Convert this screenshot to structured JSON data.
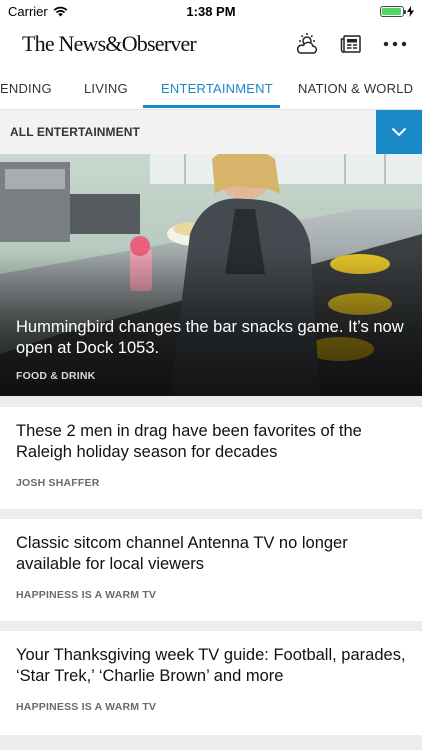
{
  "status_bar": {
    "carrier": "Carrier",
    "time": "1:38 PM",
    "battery_level": 0.95
  },
  "header": {
    "logo": "The News&Observer",
    "icons": [
      "weather-icon",
      "e-edition-icon",
      "more-icon"
    ]
  },
  "tabs": [
    {
      "label": "ENDING",
      "active": false
    },
    {
      "label": "LIVING",
      "active": false
    },
    {
      "label": "ENTERTAINMENT",
      "active": true
    },
    {
      "label": "NATION & WORLD",
      "active": false
    }
  ],
  "section": {
    "title": "ALL ENTERTAINMENT"
  },
  "hero": {
    "headline": "Hummingbird changes the bar snacks game. It’s now open at Dock 1053.",
    "tag": "FOOD & DRINK"
  },
  "articles": [
    {
      "headline": "These 2 men in drag have been favorites of the Raleigh holiday season for decades",
      "tag": "JOSH SHAFFER"
    },
    {
      "headline": "Classic sitcom channel Antenna TV no longer available for local viewers",
      "tag": "HAPPINESS IS A WARM TV"
    },
    {
      "headline": "Your Thanksgiving week TV guide: Football, parades, ‘Star Trek,’ ‘Charlie Brown’ and more",
      "tag": "HAPPINESS IS A WARM TV"
    }
  ],
  "colors": {
    "accent": "#1a89c8",
    "battery": "#4cd964"
  }
}
